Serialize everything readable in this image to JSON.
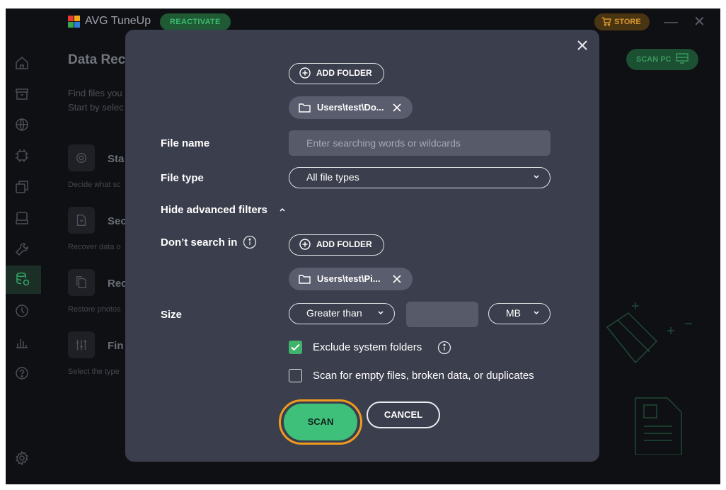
{
  "app": {
    "title": "AVG TuneUp",
    "reactivate_label": "REACTIVATE",
    "store_label": "STORE",
    "scan_pc_label": "SCAN PC"
  },
  "sidebar": {
    "items": [
      "home-icon",
      "archive-icon",
      "globe-icon",
      "cpu-icon",
      "layers-icon",
      "drive-icon",
      "wrench-icon",
      "data-recovery-icon",
      "history-icon",
      "chart-icon",
      "help-icon",
      "settings-icon"
    ],
    "active": "data-recovery-icon"
  },
  "background": {
    "heading": "Data Rec",
    "desc": "Find files you\nStart by selec",
    "cards": [
      {
        "title": "Sta",
        "sub": "Decide what sc",
        "icon": "gear-icon"
      },
      {
        "title": "Sec",
        "sub": "Recover data o",
        "icon": "shield-file-icon"
      },
      {
        "title": "Rec",
        "sub": "Restore photos",
        "icon": "file-copy-icon"
      },
      {
        "title": "Fin",
        "sub": "Select the type",
        "icon": "sliders-icon"
      }
    ]
  },
  "modal": {
    "add_folder_label": "ADD FOLDER",
    "search_in_folder": "Users\\test\\Do...",
    "file_name": {
      "label": "File name",
      "placeholder": "Enter searching words or wildcards",
      "value": ""
    },
    "file_type": {
      "label": "File type",
      "selected": "All file types"
    },
    "advanced_toggle": "Hide advanced filters",
    "dont_search": {
      "label": "Don’t search in",
      "add_folder_label": "ADD FOLDER",
      "folder": "Users\\test\\Pi..."
    },
    "size": {
      "label": "Size",
      "comparator": "Greater than",
      "value": "",
      "unit": "MB"
    },
    "exclude_system": {
      "label": "Exclude system folders",
      "checked": true
    },
    "scan_empty": {
      "label": "Scan for empty files, broken data, or duplicates",
      "checked": false
    },
    "scan_label": "SCAN",
    "cancel_label": "CANCEL"
  },
  "colors": {
    "modal_bg": "#3b3e4c",
    "accent_green": "#3fc07a",
    "highlight_orange": "#f19b1e",
    "app_bg": "#0f1014"
  }
}
